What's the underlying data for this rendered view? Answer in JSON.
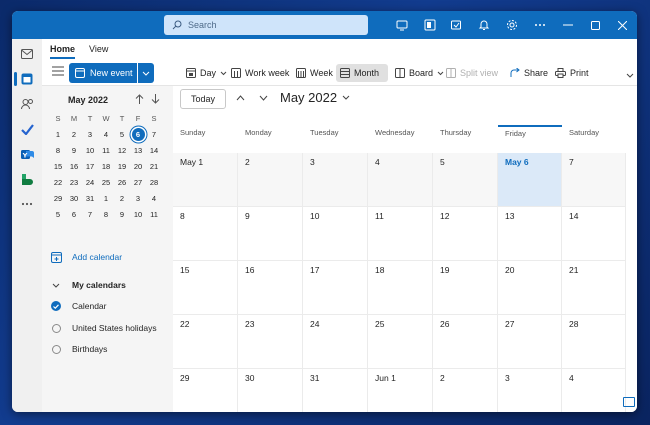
{
  "titlebar": {
    "search_placeholder": "Search"
  },
  "ribbon_tabs": [
    {
      "label": "Home"
    },
    {
      "label": "View"
    }
  ],
  "ribbon": {
    "new_event": "New event",
    "day": "Day",
    "work_week": "Work week",
    "week": "Week",
    "month": "Month",
    "board": "Board",
    "split_view": "Split view",
    "share": "Share",
    "print": "Print"
  },
  "mini_calendar": {
    "title": "May 2022",
    "weekdays": [
      "S",
      "M",
      "T",
      "W",
      "T",
      "F",
      "S"
    ],
    "weeks": [
      [
        "1",
        "2",
        "3",
        "4",
        "5",
        "6",
        "7"
      ],
      [
        "8",
        "9",
        "10",
        "11",
        "12",
        "13",
        "14"
      ],
      [
        "15",
        "16",
        "17",
        "18",
        "19",
        "20",
        "21"
      ],
      [
        "22",
        "23",
        "24",
        "25",
        "26",
        "27",
        "28"
      ],
      [
        "29",
        "30",
        "31",
        "1",
        "2",
        "3",
        "4"
      ],
      [
        "5",
        "6",
        "7",
        "8",
        "9",
        "10",
        "11"
      ]
    ],
    "selected_day": "6"
  },
  "sidebar": {
    "add_calendar": "Add calendar",
    "my_calendars": "My calendars",
    "calendars": [
      {
        "label": "Calendar",
        "checked": true
      },
      {
        "label": "United States holidays",
        "checked": false
      },
      {
        "label": "Birthdays",
        "checked": false
      }
    ]
  },
  "main": {
    "today": "Today",
    "month_title": "May 2022",
    "weekdays": [
      "Sunday",
      "Monday",
      "Tuesday",
      "Wednesday",
      "Thursday",
      "Friday",
      "Saturday"
    ],
    "weeks": [
      [
        "May 1",
        "2",
        "3",
        "4",
        "5",
        "May 6",
        "7"
      ],
      [
        "8",
        "9",
        "10",
        "11",
        "12",
        "13",
        "14"
      ],
      [
        "15",
        "16",
        "17",
        "18",
        "19",
        "20",
        "21"
      ],
      [
        "22",
        "23",
        "24",
        "25",
        "26",
        "27",
        "28"
      ],
      [
        "29",
        "30",
        "31",
        "Jun 1",
        "2",
        "3",
        "4"
      ]
    ]
  },
  "colors": {
    "accent": "#0f6cbd",
    "selected_day_bg": "#dbe9f8"
  }
}
